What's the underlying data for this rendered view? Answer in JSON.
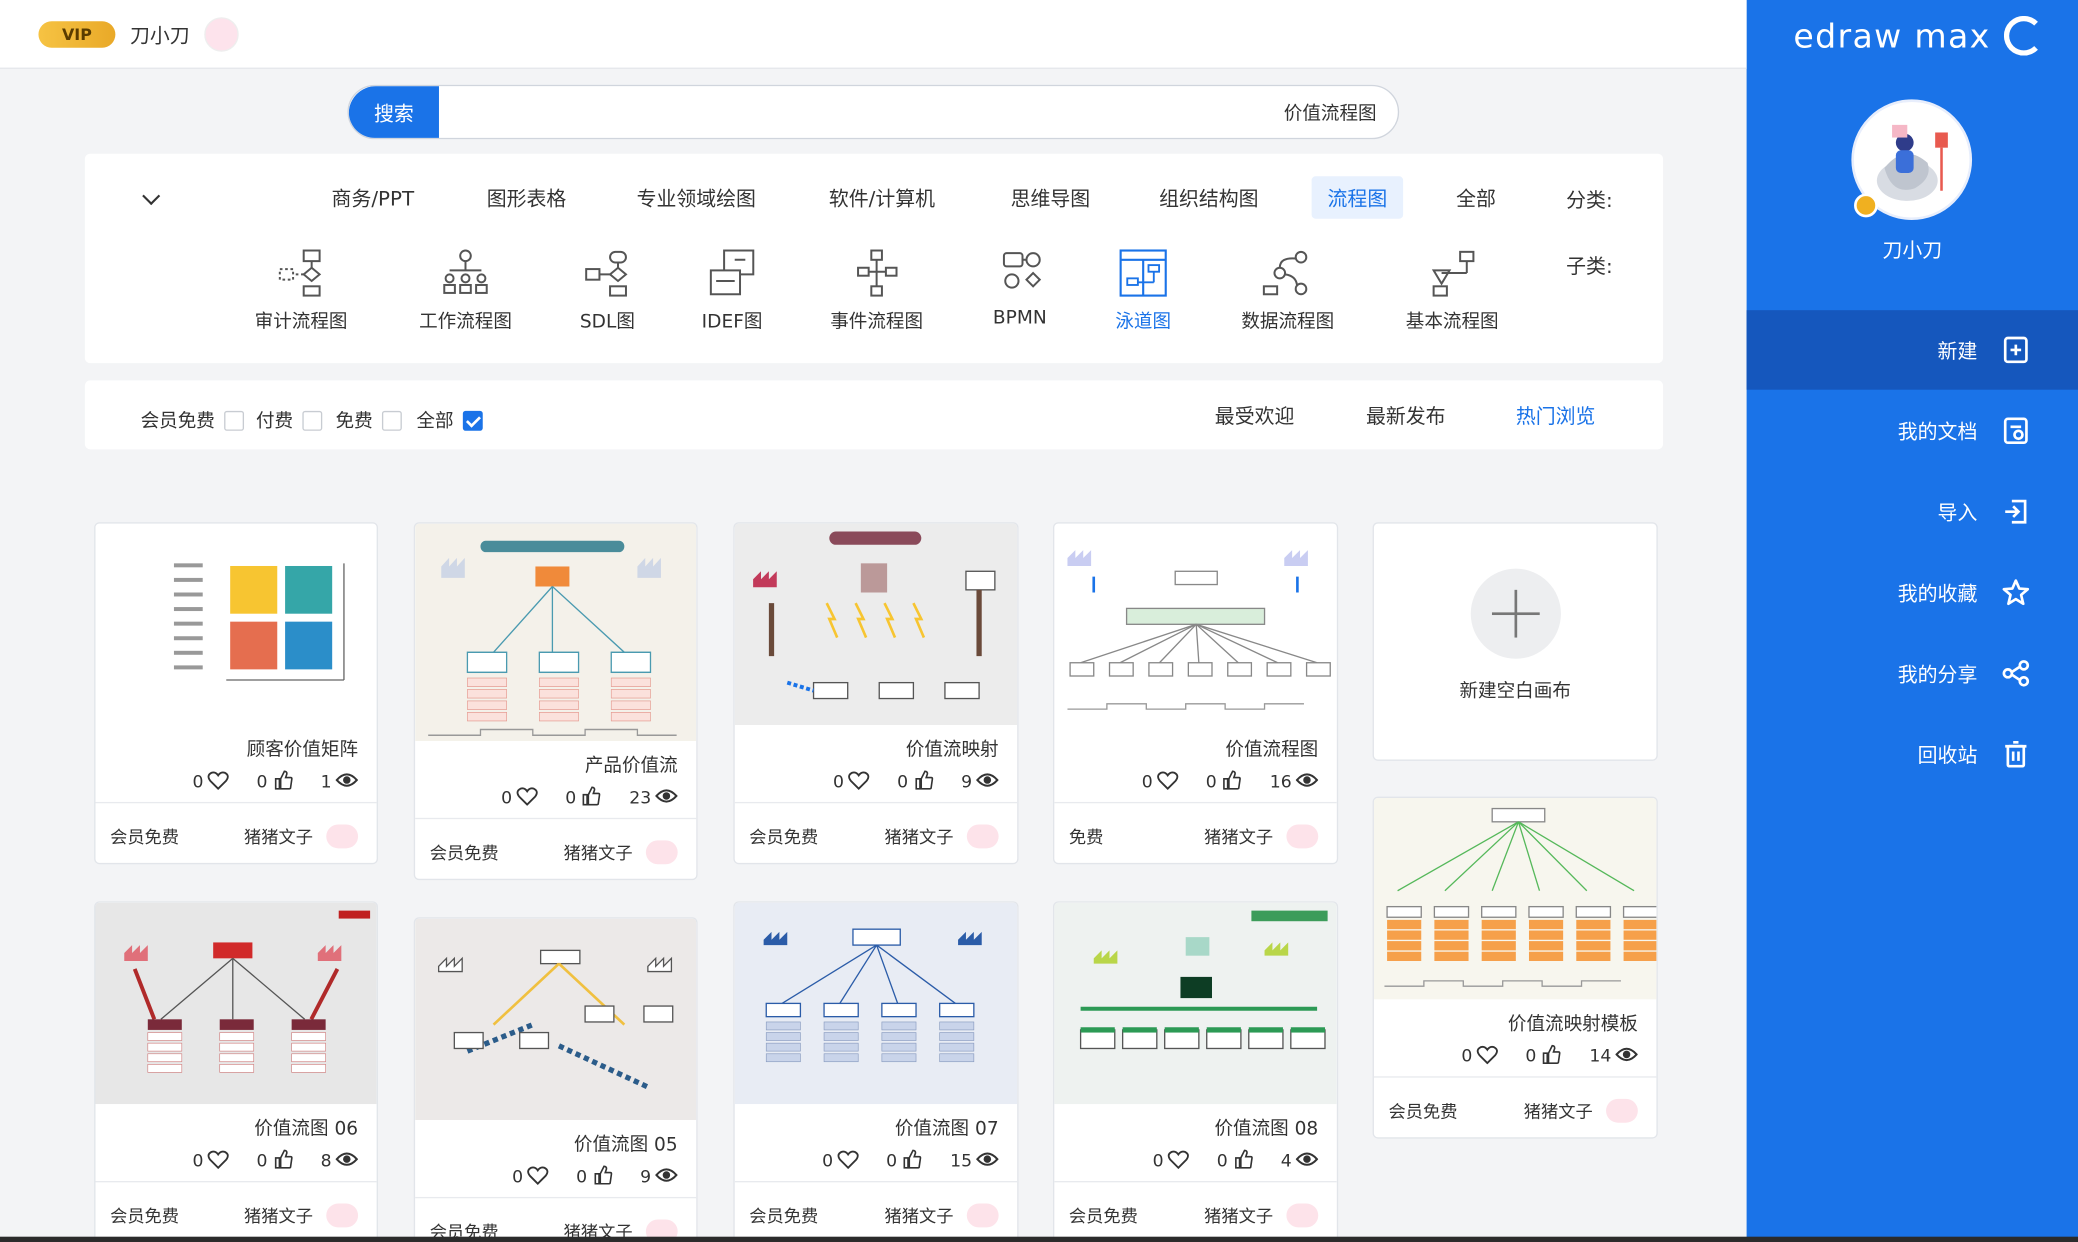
{
  "app": {
    "brand": "edraw max",
    "user_name": "刀小刀",
    "vip_badge": "VIP"
  },
  "sidebar": {
    "items": [
      {
        "label": "新建",
        "icon": "new-file-icon",
        "active": true
      },
      {
        "label": "我的文档",
        "icon": "documents-icon"
      },
      {
        "label": "导入",
        "icon": "import-icon"
      },
      {
        "label": "我的收藏",
        "icon": "star-icon"
      },
      {
        "label": "我的分享",
        "icon": "share-icon"
      },
      {
        "label": "回收站",
        "icon": "trash-icon"
      }
    ]
  },
  "search": {
    "button": "搜索",
    "value": "价值流程图"
  },
  "filters": {
    "category_label": "分类:",
    "categories": [
      "全部",
      "流程图",
      "组织结构图",
      "思维导图",
      "软件/计算机",
      "专业领域绘图",
      "图形表格",
      "商务/PPT"
    ],
    "active_category": "流程图",
    "sub_label": "子类:",
    "subcategories": [
      "基本流程图",
      "数据流程图",
      "泳道图",
      "BPMN",
      "事件流程图",
      "IDEF图",
      "SDL图",
      "工作流程图",
      "审计流程图"
    ],
    "active_subcategory": "泳道图"
  },
  "sort": {
    "options": [
      "热门浏览",
      "最新发布",
      "最受欢迎"
    ],
    "active": "热门浏览",
    "checks": [
      {
        "label": "全部",
        "checked": true
      },
      {
        "label": "免费",
        "checked": false
      },
      {
        "label": "付费",
        "checked": false
      },
      {
        "label": "会员免费",
        "checked": false
      }
    ]
  },
  "new_canvas": {
    "label": "新建空白画布"
  },
  "cards": [
    {
      "title": "价值流程图",
      "views": "16",
      "likes": "0",
      "favs": "0",
      "author": "猪猪文子",
      "price": "免费"
    },
    {
      "title": "价值流映射",
      "views": "9",
      "likes": "0",
      "favs": "0",
      "author": "猪猪文子",
      "price": "会员免费"
    },
    {
      "title": "产品价值流",
      "views": "23",
      "likes": "0",
      "favs": "0",
      "author": "猪猪文子",
      "price": "会员免费"
    },
    {
      "title": "顾客价值矩阵",
      "views": "1",
      "likes": "0",
      "favs": "0",
      "author": "猪猪文子",
      "price": "会员免费"
    },
    {
      "title": "价值流映射模板",
      "views": "14",
      "likes": "0",
      "favs": "0",
      "author": "猪猪文子",
      "price": "会员免费"
    },
    {
      "title": "价值流图 08",
      "views": "4",
      "likes": "0",
      "favs": "0",
      "author": "猪猪文子",
      "price": "会员免费"
    },
    {
      "title": "价值流图 07",
      "views": "15",
      "likes": "0",
      "favs": "0",
      "author": "猪猪文子",
      "price": "会员免费"
    },
    {
      "title": "价值流图 05",
      "views": "9",
      "likes": "0",
      "favs": "0",
      "author": "猪猪文子",
      "price": "会员免费"
    },
    {
      "title": "价值流图 06",
      "views": "8",
      "likes": "0",
      "favs": "0",
      "author": "猪猪文子",
      "price": "会员免费"
    }
  ],
  "colors": {
    "accent": "#1a73e8",
    "sidebar": "#1a73e8",
    "sidebar_active": "#1557bd",
    "vip_gold": "#f0b020"
  }
}
